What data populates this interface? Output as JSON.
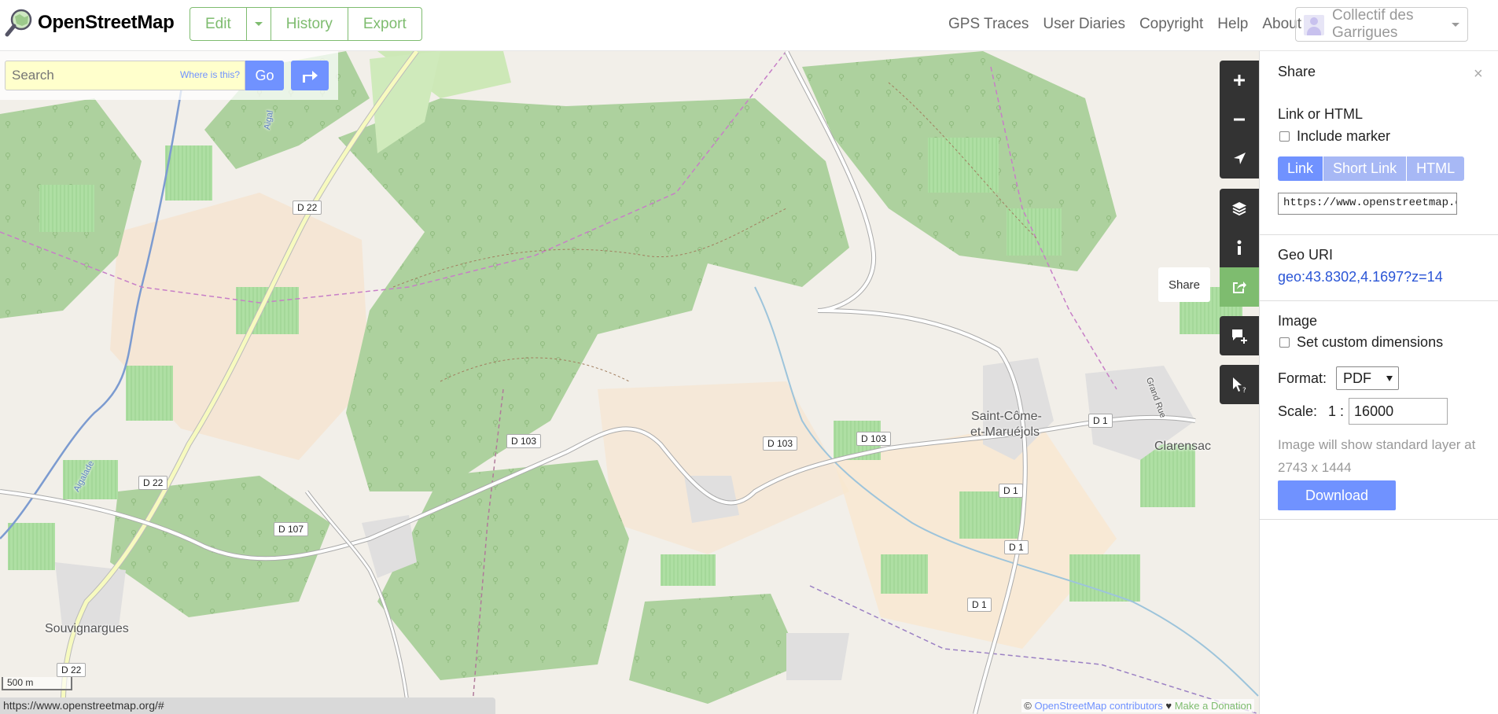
{
  "header": {
    "logo_text": "OpenStreetMap",
    "edit_group": {
      "edit": "Edit",
      "history": "History",
      "export": "Export"
    },
    "nav_links": [
      "GPS Traces",
      "User Diaries",
      "Copyright",
      "Help",
      "About"
    ],
    "user": "Collectif des Garrigues"
  },
  "search": {
    "placeholder": "Search",
    "where_is_this": "Where is this?",
    "go": "Go"
  },
  "map": {
    "road_labels": [
      "D 22",
      "D 22",
      "D 107",
      "D 103",
      "D 103",
      "D 103",
      "D 1",
      "D 1",
      "D 1",
      "D 1",
      "D 22"
    ],
    "place_labels": {
      "souvignargues": "Souvignargues",
      "saint_come_1": "Saint-Côme-",
      "saint_come_2": "et-Maruéjols",
      "clarensac": "Clarensac",
      "grand_rue": "Grand Rue",
      "aigalade": "Aigalade",
      "aigal": "Aigal"
    },
    "share_tooltip": "Share",
    "scale": "500 m",
    "status_url": "https://www.openstreetmap.org/#",
    "attribution": {
      "prefix": "© ",
      "contributors": "OpenStreetMap contributors",
      "heart": " ♥ ",
      "donate": "Make a Donation"
    },
    "colors": {
      "forest": "#add19e",
      "farmland": "#eef0d5",
      "vineyard": "#aedfa3",
      "residential": "#e0dfdf",
      "background": "#f2efe9",
      "road_primary": "#f7fabf",
      "water": "#aad3df"
    }
  },
  "sidebar": {
    "title": "Share",
    "close": "×",
    "link_section": {
      "heading": "Link or HTML",
      "include_marker": "Include marker",
      "tabs": [
        "Link",
        "Short Link",
        "HTML"
      ],
      "url": "https://www.openstreetmap.org/"
    },
    "geo_section": {
      "heading": "Geo URI",
      "uri": "geo:43.8302,4.1697?z=14"
    },
    "image_section": {
      "heading": "Image",
      "custom_dimensions": "Set custom dimensions",
      "format_label": "Format:",
      "format_value": "PDF",
      "scale_label": "Scale:",
      "scale_prefix": "1 :",
      "scale_value": "16000",
      "note_line1": "Image will show standard layer at",
      "note_line2": "2743 x 1444",
      "download": "Download"
    }
  }
}
